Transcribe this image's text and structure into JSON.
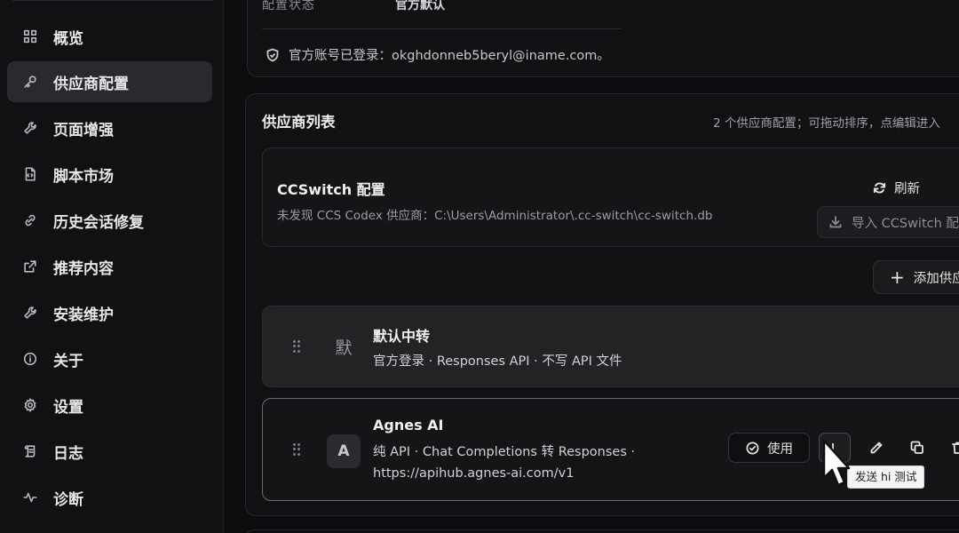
{
  "sidebar": {
    "items": [
      {
        "label": "概览",
        "icon": "grid-icon",
        "active": false
      },
      {
        "label": "供应商配置",
        "icon": "key-icon",
        "active": true
      },
      {
        "label": "页面增强",
        "icon": "wrench-icon",
        "active": false
      },
      {
        "label": "脚本市场",
        "icon": "script-file-icon",
        "active": false
      },
      {
        "label": "历史会话修复",
        "icon": "link-icon",
        "active": false
      },
      {
        "label": "推荐内容",
        "icon": "external-link-icon",
        "active": false
      },
      {
        "label": "安装维护",
        "icon": "wrench-icon",
        "active": false
      },
      {
        "label": "关于",
        "icon": "info-icon",
        "active": false
      },
      {
        "label": "设置",
        "icon": "gear-icon",
        "active": false
      },
      {
        "label": "日志",
        "icon": "scroll-icon",
        "active": false
      },
      {
        "label": "诊断",
        "icon": "activity-icon",
        "active": false
      }
    ]
  },
  "top_card": {
    "cut_label": "配置状态",
    "cut_value": "官方默认",
    "login_text": "官方账号已登录：okghdonneb5beryl@iname.com。"
  },
  "provider_list": {
    "title": "供应商列表",
    "hint": "2 个供应商配置；可拖动排序，点编辑进入",
    "ccswitch": {
      "title": "CCSwitch 配置",
      "description": "未发现 CCS Codex 供应商：C:\\Users\\Administrator\\.cc-switch\\cc-switch.db",
      "refresh_label": "刷新",
      "import_label": "导入 CCSwitch 配置"
    },
    "add_label": "添加供应商",
    "providers": [
      {
        "avatar": "默",
        "name": "默认中转",
        "description": "官方登录 · Responses API · 不写 API 文件"
      },
      {
        "avatar": "A",
        "name": "Agnes AI",
        "description": "纯 API · Chat Completions 转 Responses · https://apihub.agnes-ai.com/v1",
        "use_label": "使用"
      }
    ]
  },
  "tooltip": "发送 hi 测试",
  "colors": {
    "background": "#0d0d0f",
    "sidebar_active": "#2a2a2e",
    "card_border": "#26262a",
    "selected_border": "#6a6a70"
  }
}
